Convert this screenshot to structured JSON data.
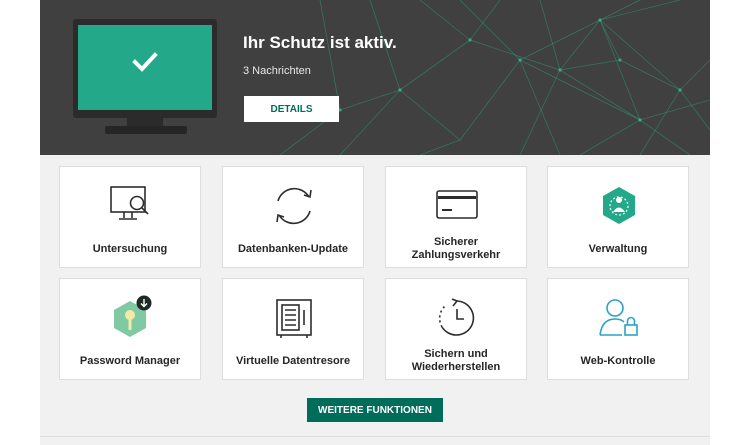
{
  "status": {
    "title": "Ihr Schutz ist aktiv.",
    "subtitle": "3 Nachrichten",
    "details_label": "DETAILS"
  },
  "tiles": [
    {
      "label": "Untersuchung",
      "icon": "monitor-magnifier-icon"
    },
    {
      "label": "Datenbanken-Update",
      "icon": "refresh-arrows-icon"
    },
    {
      "label": "Sicherer Zahlungsverkehr",
      "icon": "credit-card-icon"
    },
    {
      "label": "Verwaltung",
      "icon": "admin-hexagon-icon"
    },
    {
      "label": "Password Manager",
      "icon": "password-manager-key-icon"
    },
    {
      "label": "Virtuelle Datentresore",
      "icon": "safe-vault-icon"
    },
    {
      "label": "Sichern und Wiederherstellen",
      "icon": "backup-clock-icon"
    },
    {
      "label": "Web-Kontrolle",
      "icon": "user-lock-icon"
    }
  ],
  "more_label": "WEITERE FUNKTIONEN",
  "colors": {
    "accent": "#006d5b",
    "screen_green": "#23a889",
    "hero_bg": "#3f403f",
    "panel_bg": "#f1f1f1"
  }
}
